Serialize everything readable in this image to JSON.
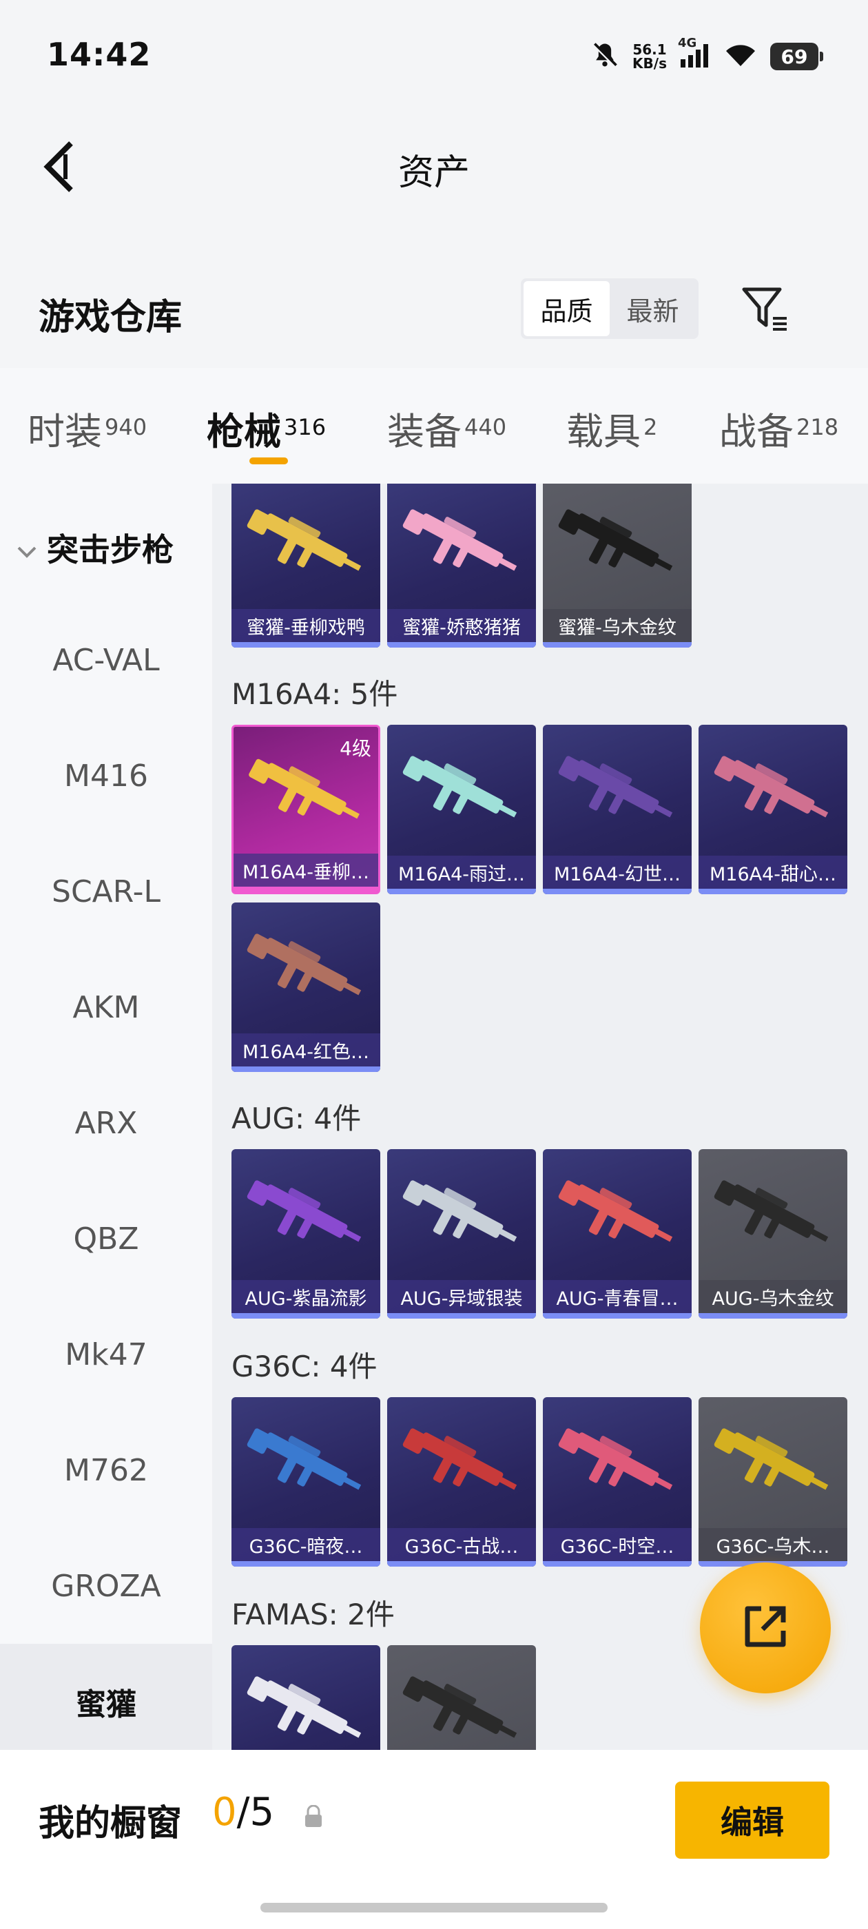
{
  "status": {
    "time": "14:42",
    "net_speed_value": "56.1",
    "net_speed_unit": "KB/s",
    "network": "4G",
    "battery": "69"
  },
  "header": {
    "title": "资产"
  },
  "warehouse": {
    "title": "游戏仓库",
    "sort_options": [
      "品质",
      "最新"
    ],
    "active_sort": "品质"
  },
  "tabs": [
    {
      "label": "时装",
      "count": "940"
    },
    {
      "label": "枪械",
      "count": "316"
    },
    {
      "label": "装备",
      "count": "440"
    },
    {
      "label": "载具",
      "count": "2"
    },
    {
      "label": "战备",
      "count": "218"
    }
  ],
  "active_tab": "枪械",
  "sidebar": {
    "group": "突击步枪",
    "items": [
      "AC-VAL",
      "M416",
      "SCAR-L",
      "AKM",
      "ARX",
      "QBZ",
      "Mk47",
      "M762",
      "GROZA",
      "蜜獾"
    ],
    "active": "蜜獾"
  },
  "sections": [
    {
      "title": "",
      "items": [
        {
          "name": "蜜獾-垂柳戏鸭",
          "style": "purple",
          "color": "#e8c14a"
        },
        {
          "name": "蜜獾-娇憨猪猪",
          "style": "purple",
          "color": "#f2a6c8"
        },
        {
          "name": "蜜獾-乌木金纹",
          "style": "gray",
          "color": "#1c1c1c"
        }
      ]
    },
    {
      "title": "M16A4: 5件",
      "items": [
        {
          "name": "M16A4-垂柳…",
          "style": "pink",
          "color": "#f0c040",
          "level": "4级"
        },
        {
          "name": "M16A4-雨过…",
          "style": "purple",
          "color": "#9fe0d8"
        },
        {
          "name": "M16A4-幻世…",
          "style": "purple",
          "color": "#6a4aa8"
        },
        {
          "name": "M16A4-甜心…",
          "style": "purple",
          "color": "#d07090"
        },
        {
          "name": "M16A4-红色…",
          "style": "purple",
          "color": "#b07060"
        }
      ]
    },
    {
      "title": "AUG: 4件",
      "items": [
        {
          "name": "AUG-紫晶流影",
          "style": "purple",
          "color": "#8a4ad0"
        },
        {
          "name": "AUG-异域银装",
          "style": "purple",
          "color": "#c8d0d8"
        },
        {
          "name": "AUG-青春冒…",
          "style": "purple",
          "color": "#e05a5a"
        },
        {
          "name": "AUG-乌木金纹",
          "style": "gray",
          "color": "#2a2a2a"
        }
      ]
    },
    {
      "title": "G36C: 4件",
      "items": [
        {
          "name": "G36C-暗夜…",
          "style": "purple",
          "color": "#3a7ad0"
        },
        {
          "name": "G36C-古战…",
          "style": "purple",
          "color": "#c83a3a"
        },
        {
          "name": "G36C-时空…",
          "style": "purple",
          "color": "#e05a7a"
        },
        {
          "name": "G36C-乌木…",
          "style": "gray",
          "color": "#d4b020"
        }
      ]
    },
    {
      "title": "FAMAS: 2件",
      "items": [
        {
          "name": "",
          "style": "purple",
          "color": "#e8e8f0"
        },
        {
          "name": "",
          "style": "gray",
          "color": "#2a2a2a"
        }
      ]
    }
  ],
  "showcase": {
    "title": "我的橱窗",
    "current": "0",
    "total": "/5",
    "edit_label": "编辑"
  },
  "colors": {
    "accent": "#f4a300",
    "edit_button": "#f7b500",
    "card_bar": "#7b8df5"
  },
  "icons": [
    "back-arrow-icon",
    "filter-icon",
    "share-external-icon",
    "lock-icon",
    "chevron-down-icon",
    "mute-bell-icon",
    "signal-icon",
    "wifi-icon"
  ]
}
